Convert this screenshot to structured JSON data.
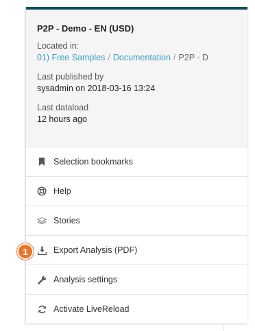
{
  "app": {
    "title": "P2P - Demo - EN (USD)",
    "located_label": "Located in:",
    "breadcrumb": [
      "01) Free Samples",
      "Documentation",
      "P2P - D"
    ],
    "breadcrumb_sep": "/",
    "published_label": "Last published by",
    "published_value": "sysadmin on 2018-03-16 13:24",
    "dataload_label": "Last dataload",
    "dataload_value": "12 hours ago"
  },
  "menu": {
    "items": [
      {
        "label": "Selection bookmarks",
        "icon": "bookmark-icon"
      },
      {
        "label": "Help",
        "icon": "lifebuoy-icon"
      },
      {
        "label": "Stories",
        "icon": "stack-icon"
      },
      {
        "label": "Export Analysis (PDF)",
        "icon": "download-icon"
      },
      {
        "label": "Analysis settings",
        "icon": "wrench-icon"
      },
      {
        "label": "Activate LiveReload",
        "icon": "refresh-icon"
      }
    ]
  },
  "badge": {
    "text": "1",
    "color": "#e8772e"
  },
  "colors": {
    "topbar": "#164b5b",
    "link": "#3a9ec4",
    "badge": "#e8772e"
  }
}
